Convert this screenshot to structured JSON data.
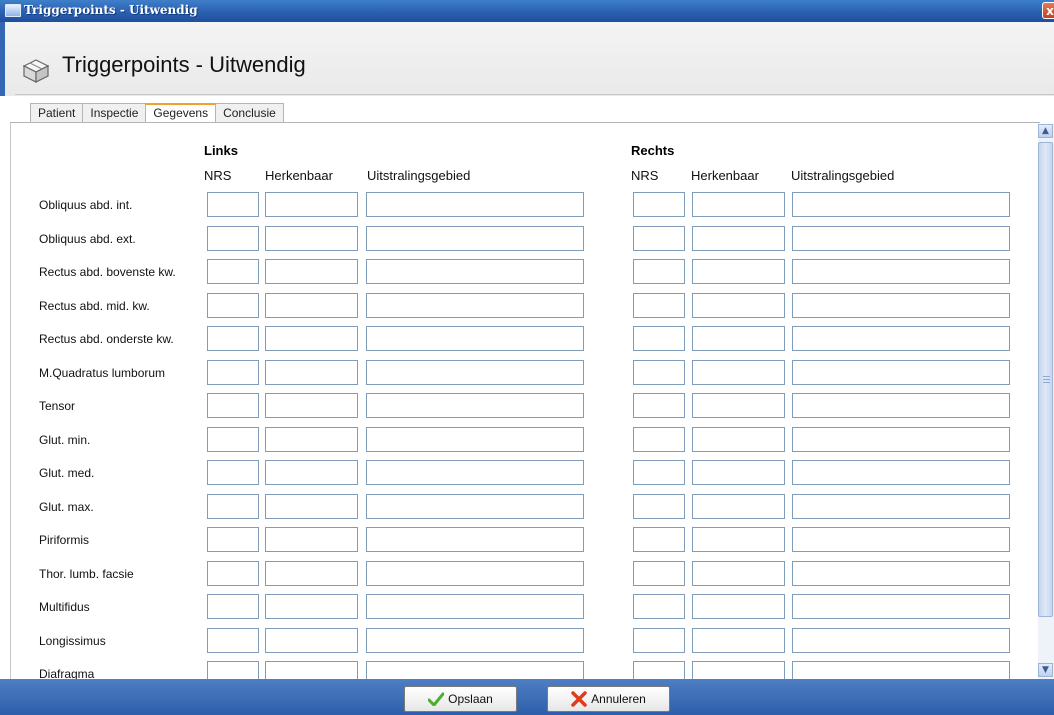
{
  "window": {
    "title": "Triggerpoints - Uitwendig",
    "close_glyph": "x"
  },
  "header": {
    "title": "Triggerpoints - Uitwendig",
    "icon": "box-icon"
  },
  "tabs": [
    {
      "label": "Patient",
      "active": false
    },
    {
      "label": "Inspectie",
      "active": false
    },
    {
      "label": "Gegevens",
      "active": true
    },
    {
      "label": "Conclusie",
      "active": false
    }
  ],
  "left_group": {
    "title": "Links",
    "col_nrs": "NRS",
    "col_herkenbaar": "Herkenbaar",
    "col_uitstraling": "Uitstralingsgebied"
  },
  "right_group": {
    "title": "Rechts",
    "col_nrs": "NRS",
    "col_herkenbaar": "Herkenbaar",
    "col_uitstraling": "Uitstralingsgebied"
  },
  "rows": [
    {
      "label": "Obliquus abd. int."
    },
    {
      "label": "Obliquus abd. ext."
    },
    {
      "label": "Rectus abd. bovenste kw."
    },
    {
      "label": "Rectus abd. mid. kw."
    },
    {
      "label": "Rectus abd. onderste kw."
    },
    {
      "label": "M.Quadratus lumborum"
    },
    {
      "label": "Tensor"
    },
    {
      "label": "Glut. min."
    },
    {
      "label": "Glut. med."
    },
    {
      "label": "Glut. max."
    },
    {
      "label": "Piriformis"
    },
    {
      "label": "Thor. lumb. facsie"
    },
    {
      "label": "Multifidus"
    },
    {
      "label": "Longissimus"
    },
    {
      "label": "Diafragma"
    }
  ],
  "footer": {
    "save_label": "Opslaan",
    "cancel_label": "Annuleren"
  },
  "colors": {
    "titlebar": "#2a60b0",
    "footer": "#3a6db6",
    "active_tab_accent": "#f0a030",
    "save_check": "#4caf2a",
    "cancel_x": "#e03c1c"
  }
}
